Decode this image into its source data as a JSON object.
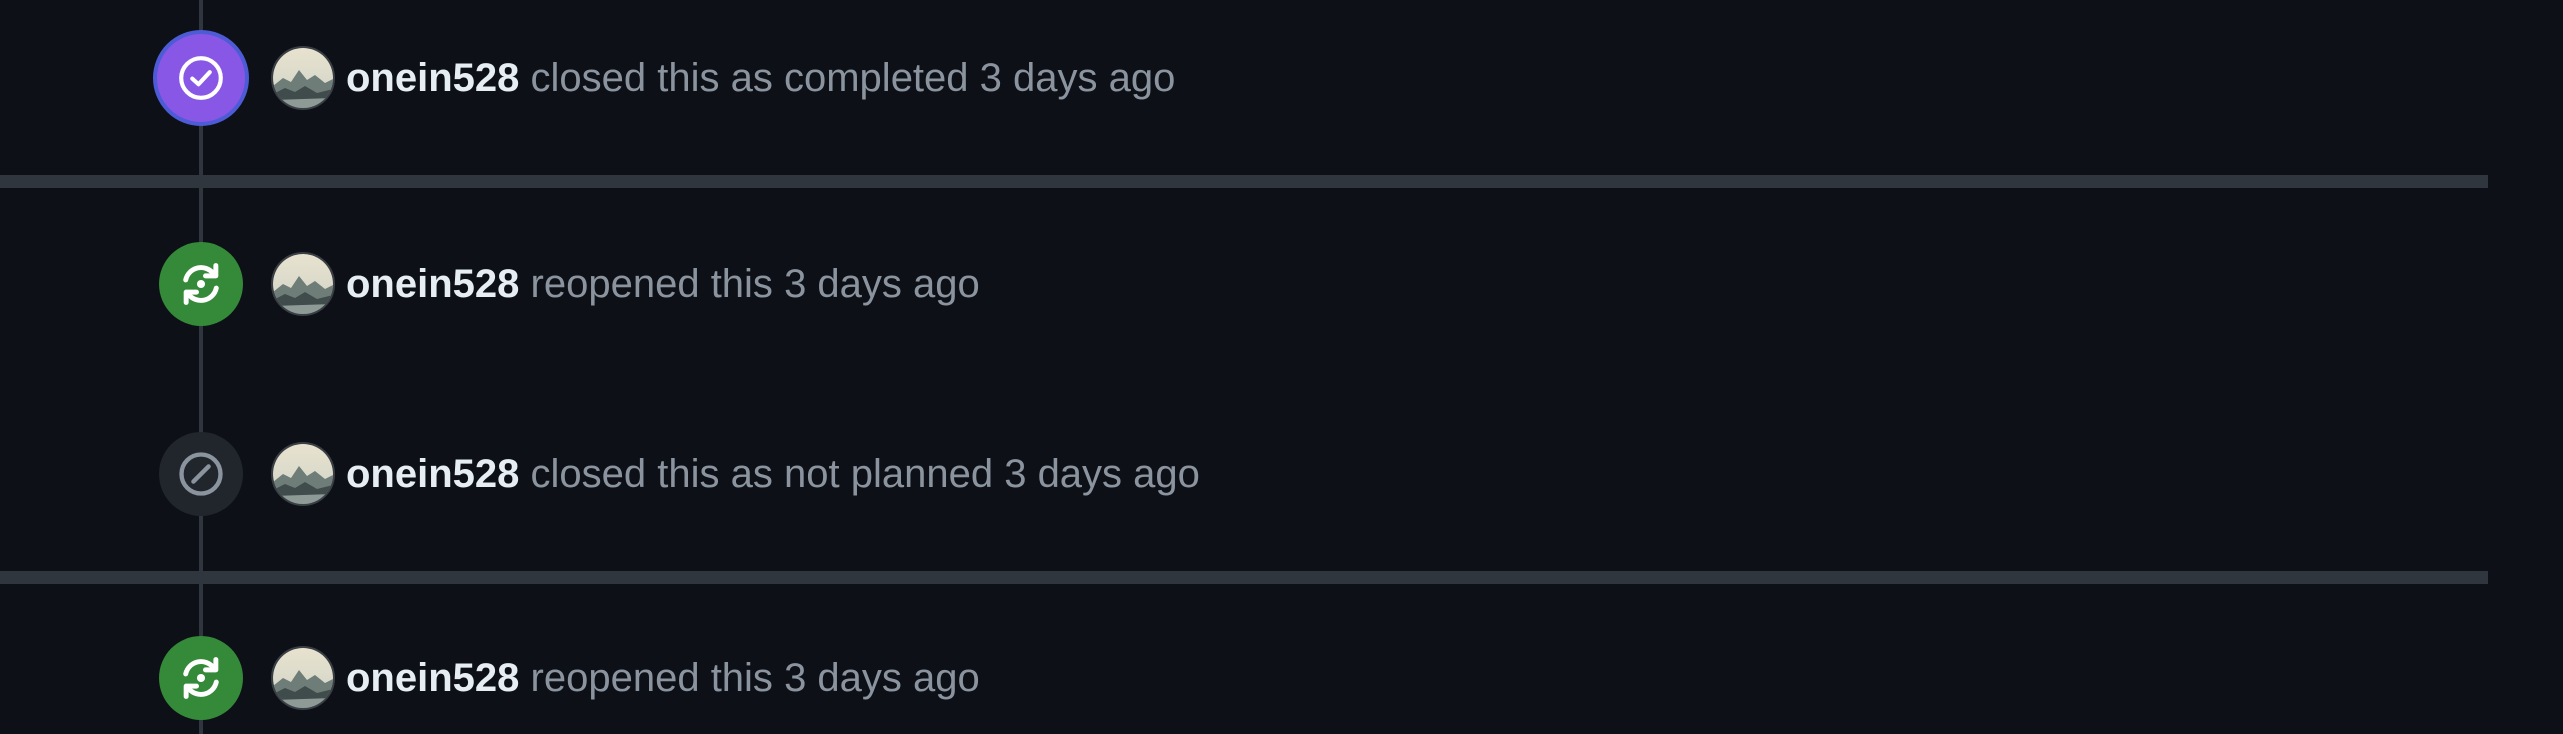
{
  "timeline": {
    "events": [
      {
        "type": "closed-completed",
        "author": "onein528",
        "action": "closed this as completed",
        "time": "3 days ago",
        "icon": "check-circle-icon",
        "badge_color": "#8957e5"
      },
      {
        "type": "reopened",
        "author": "onein528",
        "action": "reopened this",
        "time": "3 days ago",
        "icon": "sync-icon",
        "badge_color": "#348a38"
      },
      {
        "type": "closed-not-planned",
        "author": "onein528",
        "action": "closed this as not planned",
        "time": "3 days ago",
        "icon": "skip-icon",
        "badge_color": "#21262d"
      },
      {
        "type": "reopened",
        "author": "onein528",
        "action": "reopened this",
        "time": "3 days ago",
        "icon": "sync-icon",
        "badge_color": "#348a38"
      }
    ]
  },
  "colors": {
    "background": "#0d1117",
    "line": "#30363d",
    "author_text": "#e6edf3",
    "muted_text": "#8b949e"
  }
}
